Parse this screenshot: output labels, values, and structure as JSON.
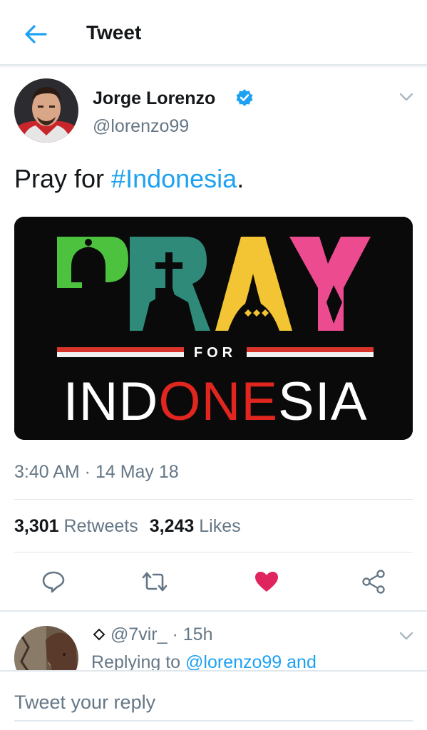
{
  "header": {
    "title": "Tweet"
  },
  "tweet": {
    "author_name": "Jorge Lorenzo",
    "handle": "@lorenzo99",
    "text_prefix": "Pray for ",
    "hashtag": "#Indonesia",
    "text_suffix": ".",
    "media": {
      "word_top": "PRAY",
      "word_mid": "FOR",
      "word_bottom": "INDONESIA"
    },
    "timestamp": "3:40 AM · 14 May 18",
    "retweets_count": "3,301",
    "retweets_label": "Retweets",
    "likes_count": "3,243",
    "likes_label": "Likes"
  },
  "reply": {
    "handle": "@7vir_",
    "time": "· 15h",
    "replying_prefix": "Replying to",
    "replying_link": "@lorenzo99 and"
  },
  "composer": {
    "placeholder": "Tweet your reply"
  },
  "colors": {
    "accent": "#1da1f2",
    "like": "#e0245e",
    "text": "#14171a",
    "muted": "#657786"
  },
  "icons": {
    "back": "arrow-left-icon",
    "verified": "verified-badge-icon",
    "caret": "chevron-down-icon",
    "reply": "reply-icon",
    "retweet": "retweet-icon",
    "like": "heart-icon",
    "share": "share-icon"
  }
}
